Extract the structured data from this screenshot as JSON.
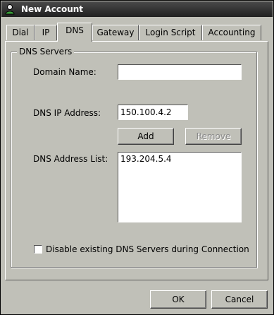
{
  "window": {
    "title": "New Account",
    "icon": "user-account-icon"
  },
  "tabs": [
    {
      "label": "Dial",
      "active": false
    },
    {
      "label": "IP",
      "active": false
    },
    {
      "label": "DNS",
      "active": true
    },
    {
      "label": "Gateway",
      "active": false
    },
    {
      "label": "Login Script",
      "active": false
    },
    {
      "label": "Accounting",
      "active": false
    }
  ],
  "dns": {
    "group_label": "DNS Servers",
    "domain_name_label": "Domain Name:",
    "domain_name_value": "",
    "dns_ip_label": "DNS IP Address:",
    "dns_ip_value": "150.100.4.2",
    "add_label": "Add",
    "remove_label": "Remove",
    "address_list_label": "DNS Address List:",
    "address_list": [
      "193.204.5.4"
    ],
    "disable_checkbox_label": "Disable existing DNS Servers during Connection",
    "disable_checkbox_checked": false
  },
  "footer": {
    "ok_label": "OK",
    "cancel_label": "Cancel"
  }
}
